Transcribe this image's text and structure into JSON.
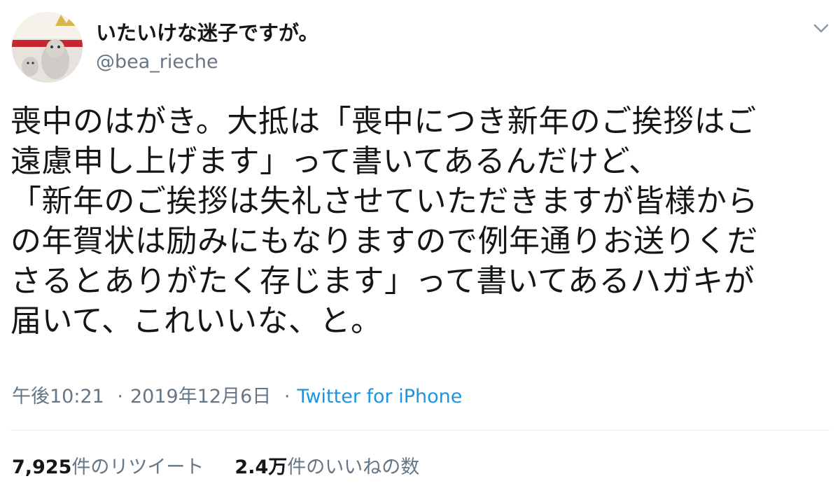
{
  "user": {
    "display_name": "いたいけな迷子ですが。",
    "handle": "@bea_rieche"
  },
  "menu_icon": "chevron-down-icon",
  "tweet": {
    "text": "喪中のはがき。大抵は「喪中につき新年のご挨拶はご\n遠慮申し上げます」って書いてあるんだけど、\n「新年のご挨拶は失礼させていただきますが皆様から\nの年賀状は励みにもなりますので例年通りお送りくだ\nさるとありがたく存じます」って書いてあるハガキが\n届いて、これいいな、と。"
  },
  "meta": {
    "time": "午後10:21",
    "date": "2019年12月6日",
    "separator": "·",
    "source": "Twitter for iPhone"
  },
  "stats": {
    "retweets_count": "7,925",
    "retweets_label": "件のリツイート",
    "likes_count": "2.4万",
    "likes_label": "件のいいねの数"
  },
  "colors": {
    "text": "#14171a",
    "secondary": "#657786",
    "link": "#1b95e0",
    "divider": "#e6ecf0"
  }
}
